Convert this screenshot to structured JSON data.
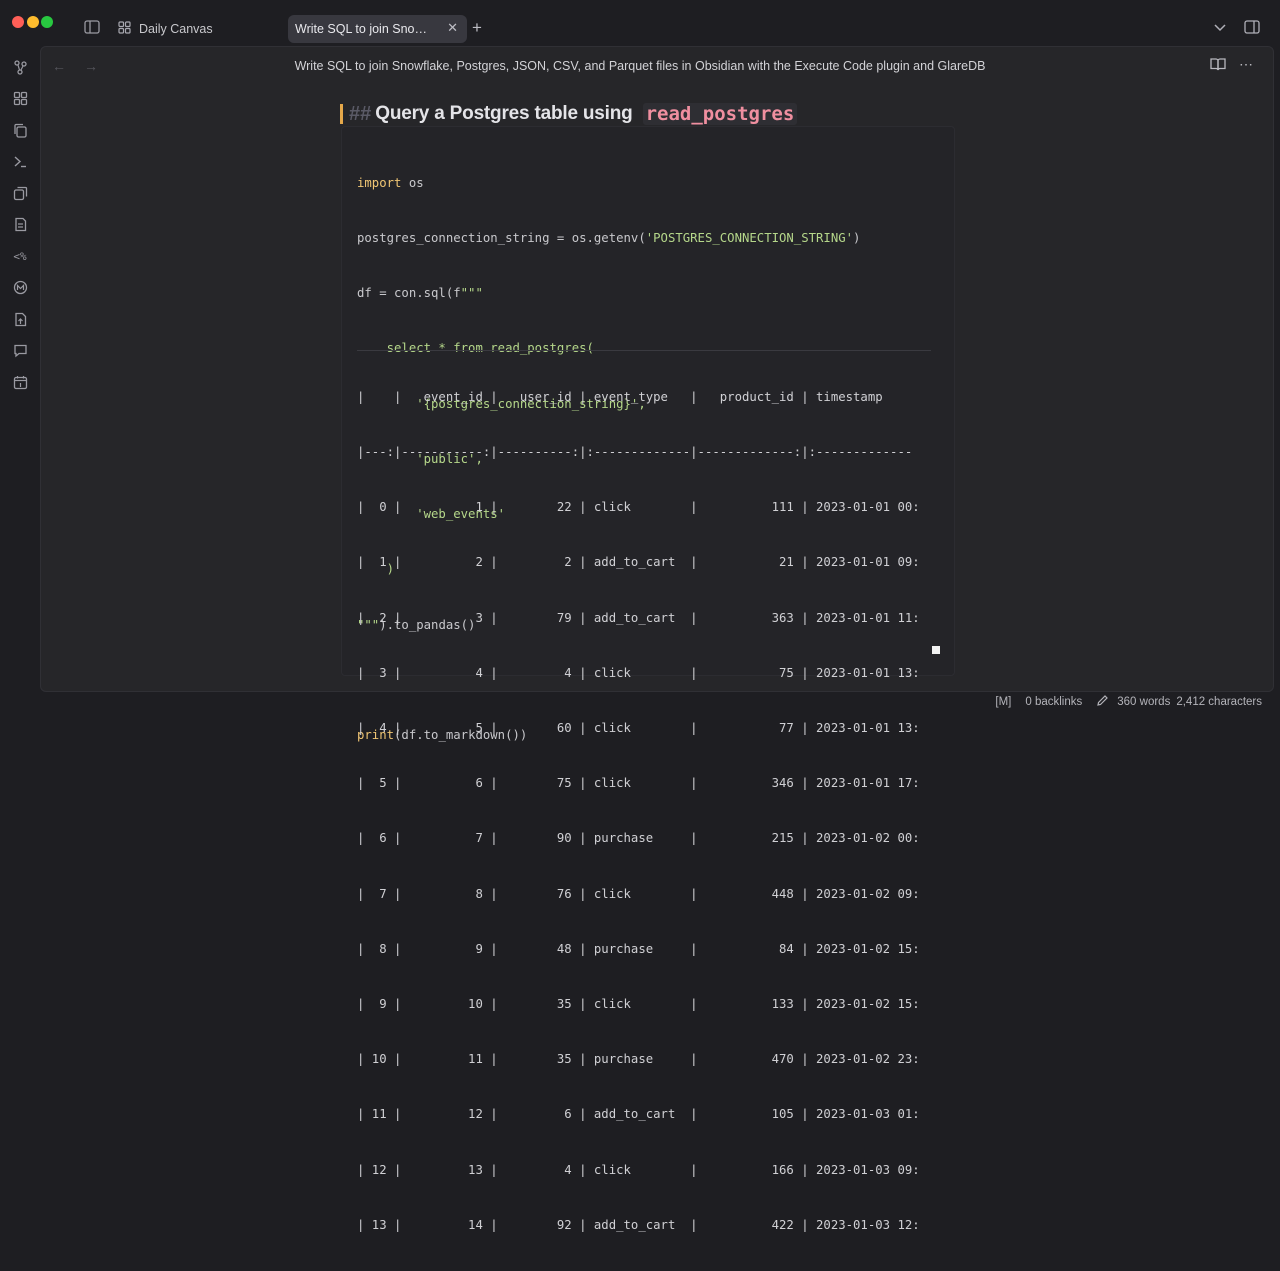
{
  "tabs": {
    "plain_label": "Daily Canvas",
    "active_label": "Write SQL to join Snowfl..."
  },
  "header": {
    "title": "Write SQL to join Snowflake, Postgres, JSON, CSV, and Parquet files in Obsidian with the Execute Code plugin and GlareDB"
  },
  "heading": {
    "hashes": "##",
    "text": "Query a Postgres table using",
    "code": "read_postgres"
  },
  "code_lines": [
    [
      "import os"
    ],
    [
      "postgres_connection_string = os.getenv(",
      "'POSTGRES_CONNECTION_STRING'",
      ")"
    ],
    [
      "df = con.sql(f\"\"\""
    ],
    [
      "    select * from read_postgres("
    ],
    [
      "        '{postgres_connection_string}',"
    ],
    [
      "        'public',"
    ],
    [
      "        'web_events'"
    ],
    [
      "    )"
    ],
    [
      "\"\"\").to_pandas()"
    ],
    [
      ""
    ],
    [
      "print(df.to_markdown())"
    ]
  ],
  "output_lines": [
    "|    |   event_id |   user_id | event_type   |   product_id | timestamp",
    "|---:|-----------:|----------:|:-------------|-------------:|:-------------",
    "|  0 |          1 |        22 | click        |          111 | 2023-01-01 00:",
    "|  1 |          2 |         2 | add_to_cart  |           21 | 2023-01-01 09:",
    "|  2 |          3 |        79 | add_to_cart  |          363 | 2023-01-01 11:",
    "|  3 |          4 |         4 | click        |           75 | 2023-01-01 13:",
    "|  4 |          5 |        60 | click        |           77 | 2023-01-01 13:",
    "|  5 |          6 |        75 | click        |          346 | 2023-01-01 17:",
    "|  6 |          7 |        90 | purchase     |          215 | 2023-01-02 00:",
    "|  7 |          8 |        76 | click        |          448 | 2023-01-02 09:",
    "|  8 |          9 |        48 | purchase     |           84 | 2023-01-02 15:",
    "|  9 |         10 |        35 | click        |          133 | 2023-01-02 15:",
    "| 10 |         11 |        35 | purchase     |          470 | 2023-01-02 23:",
    "| 11 |         12 |         6 | add_to_cart  |          105 | 2023-01-03 01:",
    "| 12 |         13 |         4 | click        |          166 | 2023-01-03 09:",
    "| 13 |         14 |        92 | add_to_cart  |          422 | 2023-01-03 12:"
  ],
  "status": {
    "mode": "[M]",
    "backlinks": "0 backlinks",
    "words": "360 words",
    "characters": "2,412 characters"
  },
  "colors": {
    "background": "#1e1e22",
    "pane": "#262629",
    "accent_cursor": "#e5a84a",
    "inline_code": "#f08fa0",
    "string": "#b5d78a",
    "keyword": "#f0c674"
  }
}
